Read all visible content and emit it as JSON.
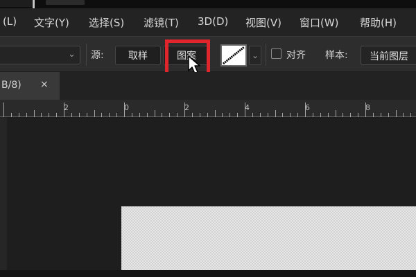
{
  "menu": {
    "items": [
      {
        "label": "(L)"
      },
      {
        "label": "文字(Y)"
      },
      {
        "label": "选择(S)"
      },
      {
        "label": "滤镜(T)"
      },
      {
        "label": "3D(D)"
      },
      {
        "label": "视图(V)"
      },
      {
        "label": "窗口(W)"
      },
      {
        "label": "帮助(H)"
      }
    ]
  },
  "options": {
    "source_label": "源:",
    "sample_button": "取样",
    "pattern_button": "图案",
    "align_label": "对齐",
    "align_checked": false,
    "sample_label": "样本:",
    "sample_value": "当前图层"
  },
  "doc_tab": {
    "title": "B/8)",
    "close": "×"
  },
  "ruler": {
    "labels": [
      "2",
      "0",
      "2",
      "4",
      "6",
      "8"
    ]
  },
  "colors": {
    "highlight": "#e0262c",
    "menubar_bg": "#232323",
    "optionbar_bg": "#2d2d2d",
    "workspace_bg": "#1e1e1e"
  },
  "icons": {
    "cursor": "arrow-cursor-icon",
    "pattern_swatch": "pattern-swatch-icon",
    "dropdown": "chevron-down-icon",
    "close": "close-icon"
  }
}
